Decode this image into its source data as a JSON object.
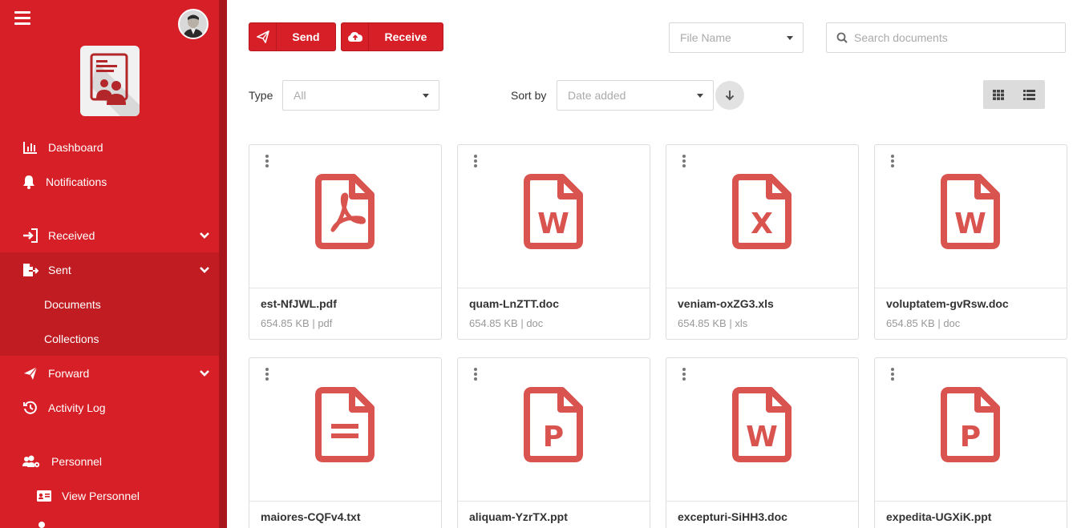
{
  "colors": {
    "brand": "#d61f26",
    "brand_dark": "#c01c22",
    "file_icon": "#d9534f"
  },
  "sidebar": {
    "menu_icon": "hamburger-icon",
    "avatar": "user-avatar",
    "logo": "document-people-logo",
    "items": [
      {
        "label": "Dashboard",
        "icon": "bar-chart-icon"
      },
      {
        "label": "Notifications",
        "icon": "bell-icon"
      },
      {
        "label": "Received",
        "icon": "sign-in-icon"
      },
      {
        "label": "Sent",
        "icon": "file-export-icon"
      },
      {
        "label": "Forward",
        "icon": "paper-plane-icon"
      },
      {
        "label": "Activity Log",
        "icon": "history-icon"
      },
      {
        "label": "Personnel",
        "icon": "users-cog-icon"
      }
    ],
    "sent_sub": [
      "Documents",
      "Collections"
    ],
    "personnel_sub": [
      "View Personnel"
    ]
  },
  "toolbar": {
    "send_label": "Send",
    "receive_label": "Receive",
    "filename_select": "File Name",
    "search_placeholder": "Search documents"
  },
  "filters": {
    "type_label": "Type",
    "type_value": "All",
    "sort_label": "Sort by",
    "sort_value": "Date added"
  },
  "files": [
    {
      "name": "est-NfJWL.pdf",
      "meta": "654.85 KB | pdf",
      "kind": "pdf"
    },
    {
      "name": "quam-LnZTT.doc",
      "meta": "654.85 KB | doc",
      "kind": "W"
    },
    {
      "name": "veniam-oxZG3.xls",
      "meta": "654.85 KB | xls",
      "kind": "X"
    },
    {
      "name": "voluptatem-gvRsw.doc",
      "meta": "654.85 KB | doc",
      "kind": "W"
    },
    {
      "name": "maiores-CQFv4.txt",
      "meta": "",
      "kind": "txt"
    },
    {
      "name": "aliquam-YzrTX.ppt",
      "meta": "",
      "kind": "P"
    },
    {
      "name": "excepturi-SiHH3.doc",
      "meta": "",
      "kind": "W"
    },
    {
      "name": "expedita-UGXiK.ppt",
      "meta": "",
      "kind": "P"
    }
  ]
}
